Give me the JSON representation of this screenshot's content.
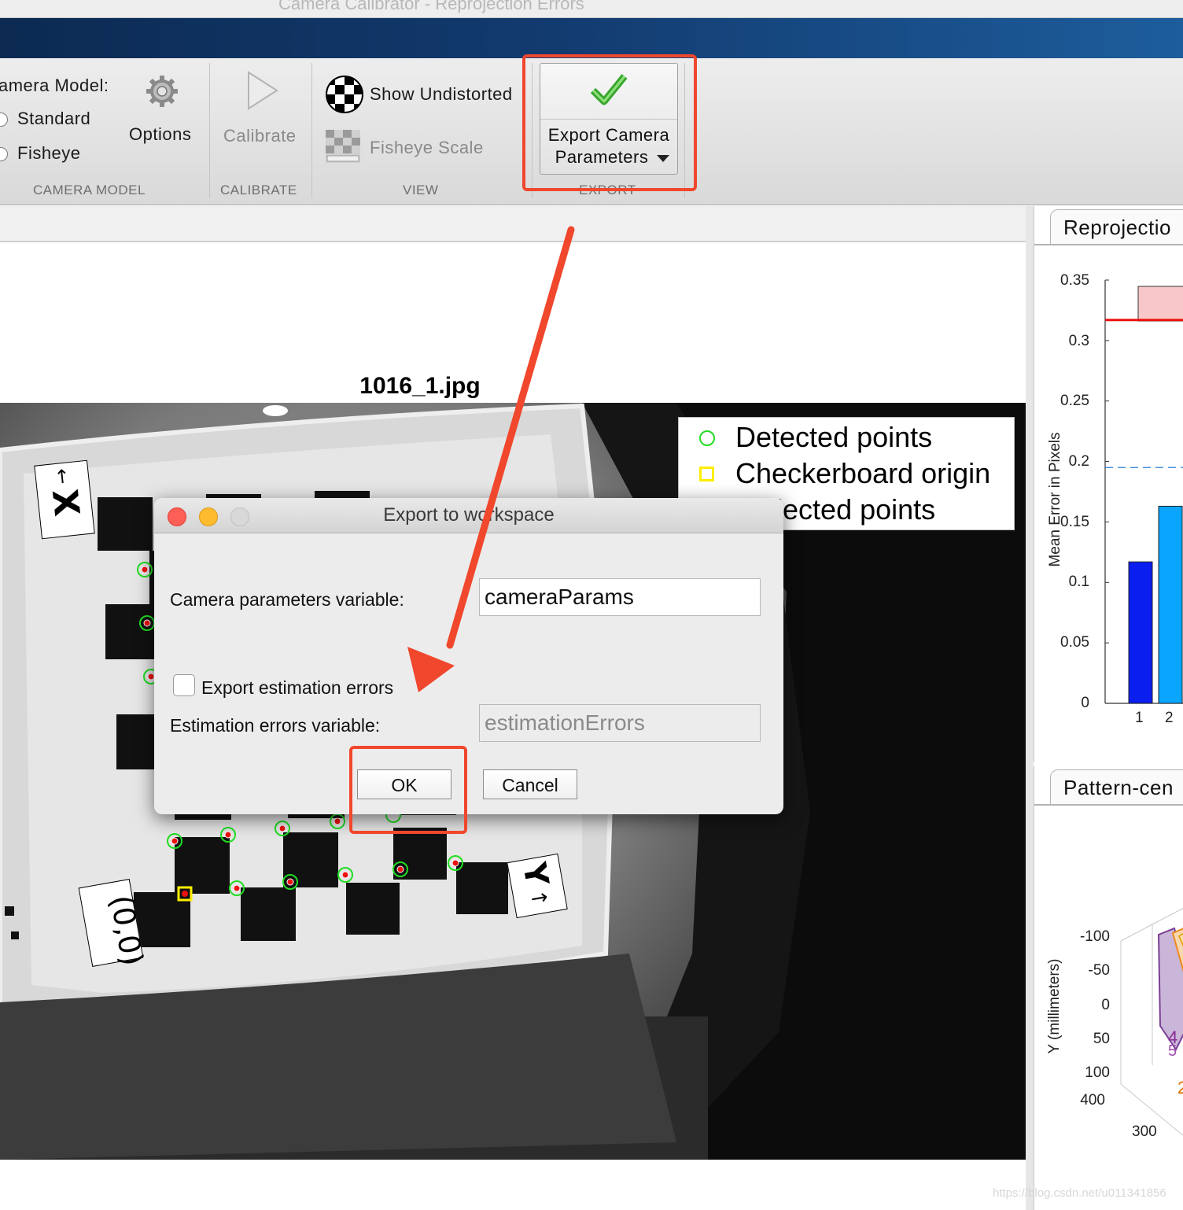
{
  "window": {
    "title": "Camera Calibrator - Reprojection Errors"
  },
  "toolstrip": {
    "camera_model_label": "amera Model:",
    "radio_standard": "Standard",
    "radio_fisheye": "Fisheye",
    "options_label": "Options",
    "calibrate_label": "Calibrate",
    "show_undistorted_label": "Show Undistorted",
    "fisheye_scale_label": "Fisheye Scale",
    "export_line1": "Export Camera",
    "export_line2": "Parameters",
    "sections": {
      "camera_model": "CAMERA MODEL",
      "calibrate": "CALIBRATE",
      "view": "VIEW",
      "export": "EXPORT"
    }
  },
  "image_panel": {
    "image_title": "1016_1.jpg",
    "x_axis_label": "X",
    "y_axis_label": "Y",
    "origin_label": "(0,0)",
    "legend": [
      "Detected points",
      "Checkerboard origin",
      "projected points"
    ]
  },
  "dialog": {
    "title": "Export to workspace",
    "camera_params_label": "Camera parameters variable:",
    "camera_params_value": "cameraParams",
    "export_errors_label": "Export estimation errors",
    "export_errors_checked": false,
    "errors_var_label": "Estimation errors variable:",
    "errors_var_value": "estimationErrors",
    "ok_label": "OK",
    "cancel_label": "Cancel"
  },
  "right_panel": {
    "reprojection_tab": "Reprojectio",
    "ylabel": "Mean Error in Pixels",
    "yticks": [
      "0.35",
      "0.3",
      "0.25",
      "0.2",
      "0.15",
      "0.1",
      "0.05",
      "0"
    ],
    "xticks": [
      "1",
      "2"
    ],
    "pattern_tab": "Pattern-cen",
    "pattern_ylabel": "Y (millimeters)",
    "pattern_yticks": [
      "-100",
      "-50",
      "0",
      "50",
      "100",
      "400"
    ],
    "pattern_xtick": "300"
  },
  "chart_data": {
    "type": "bar",
    "categories": [
      "1",
      "2"
    ],
    "values": [
      0.117,
      0.163
    ],
    "ylabel": "Mean Error in Pixels",
    "ylim": [
      0,
      0.35
    ],
    "overall_mean_line": 0.195,
    "colors": [
      "#0a1ef0",
      "#0aa5ff"
    ]
  },
  "watermark": "https://blog.csdn.net/u011341856",
  "colors": {
    "annotation_red": "#f0472d",
    "detected": "#22dd22",
    "origin": "#ffee00"
  }
}
